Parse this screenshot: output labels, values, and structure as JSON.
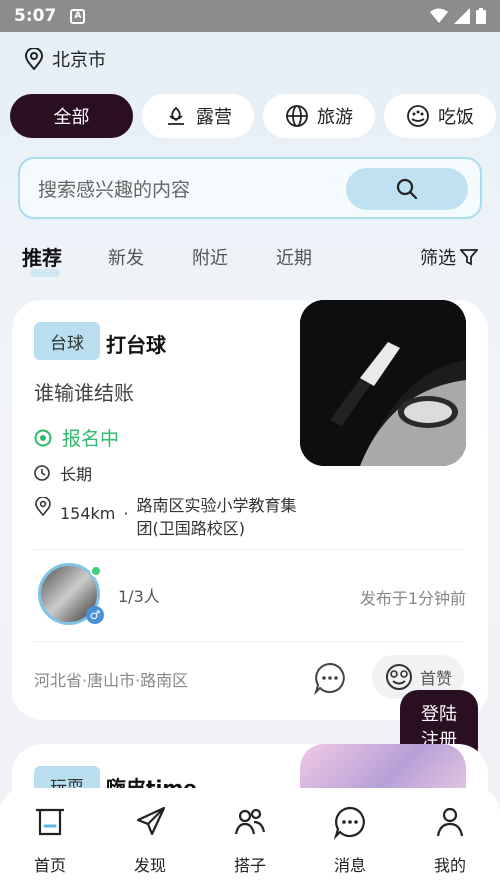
{
  "status_bar": {
    "time": "5:07",
    "a_label": "A"
  },
  "location": {
    "city": "北京市"
  },
  "categories": [
    {
      "label": "全部",
      "icon": "none"
    },
    {
      "label": "露营",
      "icon": "camp-icon"
    },
    {
      "label": "旅游",
      "icon": "globe-icon"
    },
    {
      "label": "吃饭",
      "icon": "food-icon"
    }
  ],
  "search": {
    "placeholder": "搜索感兴趣的内容"
  },
  "tabs": [
    "推荐",
    "新发",
    "附近",
    "近期"
  ],
  "filter_label": "筛选",
  "card": {
    "tag": "台球",
    "title": "打台球",
    "subtitle": "谁输谁结账",
    "status": "报名中",
    "duration": "长期",
    "distance": "154km",
    "address": "路南区实验小学教育集团(卫国路校区)",
    "count": "1/3人",
    "posted": "发布于1分钟前",
    "region": "河北省·唐山市·路南区",
    "first_like": "首赞"
  },
  "login_fab": {
    "line1": "登陆",
    "line2": "注册"
  },
  "card2": {
    "tag": "玩耍",
    "title": "嗨皮time"
  },
  "nav": [
    "首页",
    "发现",
    "搭子",
    "消息",
    "我的"
  ],
  "colors": {
    "accent_dark": "#2a0f22",
    "accent_light": "#b9def0",
    "status_green": "#2fb96b"
  }
}
